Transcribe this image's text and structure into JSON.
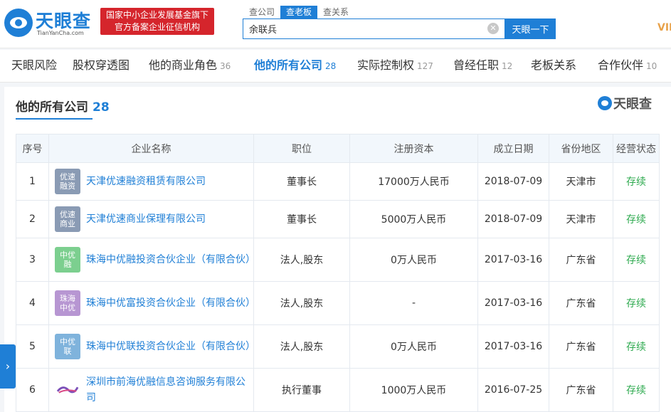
{
  "header": {
    "logo_name": "天眼查",
    "logo_domain": "TianYanCha.com",
    "banner_line1": "国家中小企业发展基金旗下",
    "banner_line2": "官方备案企业征信机构",
    "search_tabs": [
      {
        "label": "查公司",
        "active": false
      },
      {
        "label": "查老板",
        "active": true
      },
      {
        "label": "查关系",
        "active": false
      }
    ],
    "search_value": "余联兵",
    "search_button": "天眼一下",
    "vip": "VII"
  },
  "nav": [
    {
      "label": "天眼风险",
      "count": ""
    },
    {
      "label": "股权穿透图",
      "count": ""
    },
    {
      "label": "他的商业角色",
      "count": "36"
    },
    {
      "label": "他的所有公司",
      "count": "28"
    },
    {
      "label": "实际控制权",
      "count": "127"
    },
    {
      "label": "曾经任职",
      "count": "12"
    },
    {
      "label": "老板关系",
      "count": ""
    },
    {
      "label": "合作伙伴",
      "count": "10"
    }
  ],
  "section": {
    "title": "他的所有公司",
    "count": "28",
    "brand": "天眼查"
  },
  "table": {
    "headers": [
      "序号",
      "企业名称",
      "职位",
      "注册资本",
      "成立日期",
      "省份地区",
      "经营状态"
    ],
    "rows": [
      {
        "no": "1",
        "logo": "优速融资",
        "logo_color": "#8a9bb4",
        "name": "天津优速融资租赁有限公司",
        "position": "董事长",
        "capital": "17000万人民币",
        "date": "2018-07-09",
        "region": "天津市",
        "status": "存续"
      },
      {
        "no": "2",
        "logo": "优速商业",
        "logo_color": "#8a9bb4",
        "name": "天津优速商业保理有限公司",
        "position": "董事长",
        "capital": "5000万人民币",
        "date": "2018-07-09",
        "region": "天津市",
        "status": "存续"
      },
      {
        "no": "3",
        "logo": "中优融",
        "logo_color": "#7ccf8f",
        "name": "珠海中优融投资合伙企业（有限合伙）",
        "position": "法人,股东",
        "capital": "0万人民币",
        "date": "2017-03-16",
        "region": "广东省",
        "status": "存续"
      },
      {
        "no": "4",
        "logo": "珠海中优",
        "logo_color": "#b796d2",
        "name": "珠海中优富投资合伙企业（有限合伙）",
        "position": "法人,股东",
        "capital": "-",
        "date": "2017-03-16",
        "region": "广东省",
        "status": "存续"
      },
      {
        "no": "5",
        "logo": "中优联",
        "logo_color": "#7fb3dc",
        "name": "珠海中优联投资合伙企业（有限合伙）",
        "position": "法人,股东",
        "capital": "0万人民币",
        "date": "2017-03-16",
        "region": "广东省",
        "status": "存续"
      },
      {
        "no": "6",
        "logo": "",
        "logo_color": "#ffffff",
        "name": "深圳市前海优融信息咨询服务有限公司",
        "position": "执行董事",
        "capital": "1000万人民币",
        "date": "2016-07-25",
        "region": "广东省",
        "status": "存续"
      }
    ]
  },
  "colors": {
    "accent": "#1f7fd6",
    "banner": "#d5252c",
    "status_green": "#2eaa4f"
  }
}
